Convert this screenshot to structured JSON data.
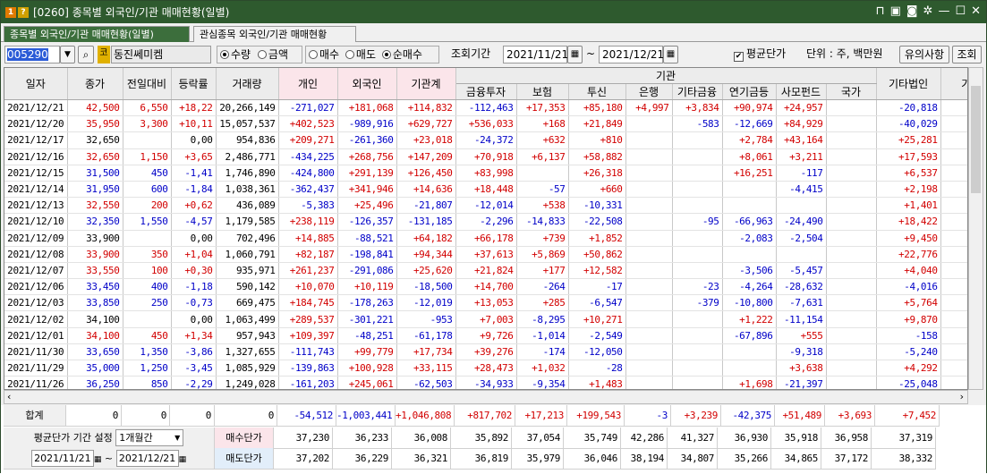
{
  "title": {
    "badge1": "1",
    "badge2": "?",
    "text": "[0260] 종목별 외국인/기관 매매현황(일별)"
  },
  "tabs": [
    {
      "label": "종목별 외국인/기관 매매현황(일별)"
    },
    {
      "label": "관심종목 외국인/기관 매매현황"
    }
  ],
  "toolbar": {
    "code": "005290",
    "stock_badge": "코",
    "stock_name": "동진쎄미켐",
    "unit_qty": "수량",
    "unit_amt": "금액",
    "buy": "매수",
    "sell": "매도",
    "net": "순매수",
    "period_label": "조회기간",
    "start": "2021/11/21",
    "end": "2021/12/21",
    "tilde": "~",
    "avg_label": "평균단가",
    "unit_label": "단위 : 주, 백만원",
    "notice": "유의사항",
    "query": "조회"
  },
  "headers": {
    "date": "일자",
    "close": "종가",
    "change": "전일대비",
    "rate": "등락률",
    "volume": "거래량",
    "indiv": "개인",
    "foreign": "외국인",
    "inst_total": "기관계",
    "inst_group": "기관",
    "fin": "금융투자",
    "ins": "보험",
    "trust": "투신",
    "bank": "은행",
    "other_fin": "기타금융",
    "pension": "연기금등",
    "pef": "사모펀드",
    "nation": "국가",
    "other_corp": "기타법인",
    "etc": "기"
  },
  "rows": [
    {
      "d": "2021/12/21",
      "c": [
        "42,500",
        "6,550",
        "+18,22",
        "20,266,149",
        "-271,027",
        "+181,068",
        "+114,832",
        "-112,463",
        "+17,353",
        "+85,180",
        "+4,997",
        "+3,834",
        "+90,974",
        "+24,957",
        "",
        "-20,818"
      ],
      "col": [
        "r",
        "r",
        "r",
        "k",
        "b",
        "r",
        "r",
        "b",
        "r",
        "r",
        "r",
        "r",
        "r",
        "r",
        "k",
        "b"
      ]
    },
    {
      "d": "2021/12/20",
      "c": [
        "35,950",
        "3,300",
        "+10,11",
        "15,057,537",
        "+402,523",
        "-989,916",
        "+629,727",
        "+536,033",
        "+168",
        "+21,849",
        "",
        "-583",
        "-12,669",
        "+84,929",
        "",
        "-40,029"
      ],
      "col": [
        "r",
        "r",
        "r",
        "k",
        "r",
        "b",
        "r",
        "r",
        "r",
        "r",
        "k",
        "b",
        "b",
        "r",
        "k",
        "b"
      ]
    },
    {
      "d": "2021/12/17",
      "c": [
        "32,650",
        "",
        "0,00",
        "954,836",
        "+209,271",
        "-261,360",
        "+23,018",
        "-24,372",
        "+632",
        "+810",
        "",
        "",
        "+2,784",
        "+43,164",
        "",
        "+25,281"
      ],
      "col": [
        "k",
        "k",
        "k",
        "k",
        "r",
        "b",
        "r",
        "b",
        "r",
        "r",
        "k",
        "k",
        "r",
        "r",
        "k",
        "r"
      ]
    },
    {
      "d": "2021/12/16",
      "c": [
        "32,650",
        "1,150",
        "+3,65",
        "2,486,771",
        "-434,225",
        "+268,756",
        "+147,209",
        "+70,918",
        "+6,137",
        "+58,882",
        "",
        "",
        "+8,061",
        "+3,211",
        "",
        "+17,593"
      ],
      "col": [
        "r",
        "r",
        "r",
        "k",
        "b",
        "r",
        "r",
        "r",
        "r",
        "r",
        "k",
        "k",
        "r",
        "r",
        "k",
        "r"
      ]
    },
    {
      "d": "2021/12/15",
      "c": [
        "31,500",
        "450",
        "-1,41",
        "1,746,890",
        "-424,800",
        "+291,139",
        "+126,450",
        "+83,998",
        "",
        "+26,318",
        "",
        "",
        "+16,251",
        "-117",
        "",
        "+6,537"
      ],
      "col": [
        "b",
        "b",
        "b",
        "k",
        "b",
        "r",
        "r",
        "r",
        "k",
        "r",
        "k",
        "k",
        "r",
        "b",
        "k",
        "r"
      ]
    },
    {
      "d": "2021/12/14",
      "c": [
        "31,950",
        "600",
        "-1,84",
        "1,038,361",
        "-362,437",
        "+341,946",
        "+14,636",
        "+18,448",
        "-57",
        "+660",
        "",
        "",
        "",
        "-4,415",
        "",
        "+2,198"
      ],
      "col": [
        "b",
        "b",
        "b",
        "k",
        "b",
        "r",
        "r",
        "r",
        "b",
        "r",
        "k",
        "k",
        "k",
        "b",
        "k",
        "r"
      ]
    },
    {
      "d": "2021/12/13",
      "c": [
        "32,550",
        "200",
        "+0,62",
        "436,089",
        "-5,383",
        "+25,496",
        "-21,807",
        "-12,014",
        "+538",
        "-10,331",
        "",
        "",
        "",
        "",
        "",
        "+1,401"
      ],
      "col": [
        "r",
        "r",
        "r",
        "k",
        "b",
        "r",
        "b",
        "b",
        "r",
        "b",
        "k",
        "k",
        "k",
        "k",
        "k",
        "r"
      ]
    },
    {
      "d": "2021/12/10",
      "c": [
        "32,350",
        "1,550",
        "-4,57",
        "1,179,585",
        "+238,119",
        "-126,357",
        "-131,185",
        "-2,296",
        "-14,833",
        "-22,508",
        "",
        "-95",
        "-66,963",
        "-24,490",
        "",
        "+18,422"
      ],
      "col": [
        "b",
        "b",
        "b",
        "k",
        "r",
        "b",
        "b",
        "b",
        "b",
        "b",
        "k",
        "b",
        "b",
        "b",
        "k",
        "r"
      ]
    },
    {
      "d": "2021/12/09",
      "c": [
        "33,900",
        "",
        "0,00",
        "702,496",
        "+14,885",
        "-88,521",
        "+64,182",
        "+66,178",
        "+739",
        "+1,852",
        "",
        "",
        "-2,083",
        "-2,504",
        "",
        "+9,450"
      ],
      "col": [
        "k",
        "k",
        "k",
        "k",
        "r",
        "b",
        "r",
        "r",
        "r",
        "r",
        "k",
        "k",
        "b",
        "b",
        "k",
        "r"
      ]
    },
    {
      "d": "2021/12/08",
      "c": [
        "33,900",
        "350",
        "+1,04",
        "1,060,791",
        "+82,187",
        "-198,841",
        "+94,344",
        "+37,613",
        "+5,869",
        "+50,862",
        "",
        "",
        "",
        "",
        "",
        "+22,776"
      ],
      "col": [
        "r",
        "r",
        "r",
        "k",
        "r",
        "b",
        "r",
        "r",
        "r",
        "r",
        "k",
        "k",
        "k",
        "k",
        "k",
        "r"
      ]
    },
    {
      "d": "2021/12/07",
      "c": [
        "33,550",
        "100",
        "+0,30",
        "935,971",
        "+261,237",
        "-291,086",
        "+25,620",
        "+21,824",
        "+177",
        "+12,582",
        "",
        "",
        "-3,506",
        "-5,457",
        "",
        "+4,040"
      ],
      "col": [
        "r",
        "r",
        "r",
        "k",
        "r",
        "b",
        "r",
        "r",
        "r",
        "r",
        "k",
        "k",
        "b",
        "b",
        "k",
        "r"
      ]
    },
    {
      "d": "2021/12/06",
      "c": [
        "33,450",
        "400",
        "-1,18",
        "590,142",
        "+10,070",
        "+10,119",
        "-18,500",
        "+14,700",
        "-264",
        "-17",
        "",
        "-23",
        "-4,264",
        "-28,632",
        "",
        "-4,016"
      ],
      "col": [
        "b",
        "b",
        "b",
        "k",
        "r",
        "r",
        "b",
        "r",
        "b",
        "b",
        "k",
        "b",
        "b",
        "b",
        "k",
        "b"
      ]
    },
    {
      "d": "2021/12/03",
      "c": [
        "33,850",
        "250",
        "-0,73",
        "669,475",
        "+184,745",
        "-178,263",
        "-12,019",
        "+13,053",
        "+285",
        "-6,547",
        "",
        "-379",
        "-10,800",
        "-7,631",
        "",
        "+5,764"
      ],
      "col": [
        "b",
        "b",
        "b",
        "k",
        "r",
        "b",
        "b",
        "r",
        "r",
        "b",
        "k",
        "b",
        "b",
        "b",
        "k",
        "r"
      ]
    },
    {
      "d": "2021/12/02",
      "c": [
        "34,100",
        "",
        "0,00",
        "1,063,499",
        "+289,537",
        "-301,221",
        "-953",
        "+7,003",
        "-8,295",
        "+10,271",
        "",
        "",
        "+1,222",
        "-11,154",
        "",
        "+9,870"
      ],
      "col": [
        "k",
        "k",
        "k",
        "k",
        "r",
        "b",
        "b",
        "r",
        "b",
        "r",
        "k",
        "k",
        "r",
        "b",
        "k",
        "r"
      ]
    },
    {
      "d": "2021/12/01",
      "c": [
        "34,100",
        "450",
        "+1,34",
        "957,943",
        "+109,397",
        "-48,251",
        "-61,178",
        "+9,726",
        "-1,014",
        "-2,549",
        "",
        "",
        "-67,896",
        "+555",
        "",
        "-158"
      ],
      "col": [
        "r",
        "r",
        "r",
        "k",
        "r",
        "b",
        "b",
        "r",
        "b",
        "b",
        "k",
        "k",
        "b",
        "r",
        "k",
        "b"
      ]
    },
    {
      "d": "2021/11/30",
      "c": [
        "33,650",
        "1,350",
        "-3,86",
        "1,327,655",
        "-111,743",
        "+99,779",
        "+17,734",
        "+39,276",
        "-174",
        "-12,050",
        "",
        "",
        "",
        "-9,318",
        "",
        "-5,240"
      ],
      "col": [
        "b",
        "b",
        "b",
        "k",
        "b",
        "r",
        "r",
        "r",
        "b",
        "b",
        "k",
        "k",
        "k",
        "b",
        "k",
        "b"
      ]
    },
    {
      "d": "2021/11/29",
      "c": [
        "35,000",
        "1,250",
        "-3,45",
        "1,085,929",
        "-139,863",
        "+100,928",
        "+33,115",
        "+28,473",
        "+1,032",
        "-28",
        "",
        "",
        "",
        "+3,638",
        "",
        "+4,292"
      ],
      "col": [
        "b",
        "b",
        "b",
        "k",
        "b",
        "r",
        "r",
        "r",
        "r",
        "b",
        "k",
        "k",
        "k",
        "r",
        "k",
        "r"
      ]
    },
    {
      "d": "2021/11/26",
      "c": [
        "36,250",
        "850",
        "-2,29",
        "1,249,028",
        "-161,203",
        "+245,061",
        "-62,503",
        "-34,933",
        "-9,354",
        "+1,483",
        "",
        "",
        "+1,698",
        "-21,397",
        "",
        "-25,048"
      ],
      "col": [
        "b",
        "b",
        "b",
        "k",
        "b",
        "r",
        "b",
        "b",
        "b",
        "r",
        "k",
        "k",
        "r",
        "b",
        "k",
        "b"
      ]
    }
  ],
  "total": {
    "label": "합계",
    "c": [
      "0",
      "0",
      "0",
      "0",
      "-54,512",
      "-1,003,441",
      "+1,046,808",
      "+817,702",
      "+17,213",
      "+199,543",
      "-3",
      "+3,239",
      "-42,375",
      "+51,489",
      "+3,693",
      "+7,452"
    ],
    "col": [
      "k",
      "k",
      "k",
      "k",
      "b",
      "b",
      "r",
      "r",
      "r",
      "r",
      "b",
      "r",
      "b",
      "r",
      "r",
      "r"
    ]
  },
  "avg": {
    "setting_label": "평균단가 기간 설정",
    "period": "1개월간",
    "start": "2021/11/21",
    "end": "2021/12/21",
    "buy_label": "매수단가",
    "sell_label": "매도단가",
    "buy": [
      "37,230",
      "36,233",
      "36,008",
      "35,892",
      "37,054",
      "35,749",
      "42,286",
      "41,327",
      "36,930",
      "35,918",
      "36,958",
      "37,319"
    ],
    "sell": [
      "37,202",
      "36,229",
      "36,321",
      "36,819",
      "35,979",
      "36,046",
      "38,194",
      "34,807",
      "35,266",
      "34,865",
      "37,172",
      "38,332"
    ]
  },
  "colors": {
    "titlebar": "#2e5a2e",
    "tab_active": "#3c6e3c",
    "up": "#d20000",
    "down": "#0000c8",
    "header_pink": "#fbe5ea"
  }
}
